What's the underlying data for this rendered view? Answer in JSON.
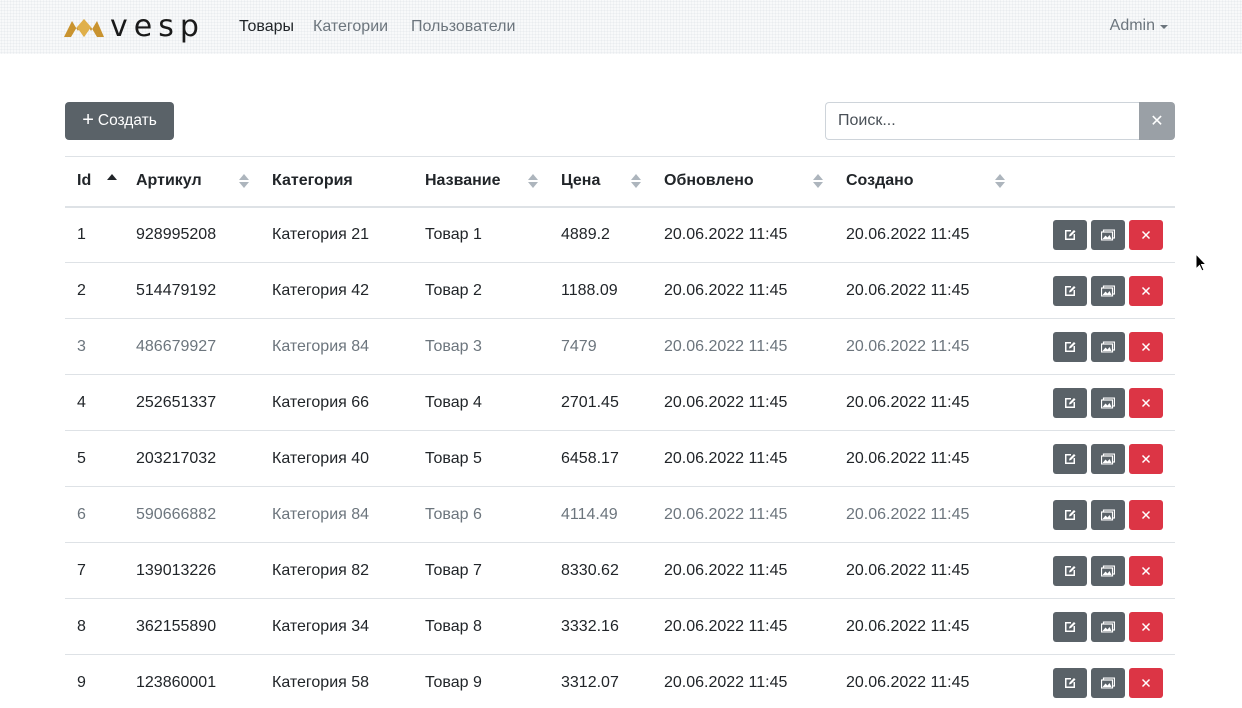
{
  "brand": {
    "name": "vesp"
  },
  "nav": {
    "items": [
      {
        "label": "Товары",
        "active": true
      },
      {
        "label": "Категории",
        "active": false
      },
      {
        "label": "Пользователи",
        "active": false
      }
    ],
    "user": "Admin"
  },
  "toolbar": {
    "create_label": "Создать",
    "search_placeholder": "Поиск...",
    "clear_symbol": "✕"
  },
  "table": {
    "columns": [
      "Id",
      "Артикул",
      "Категория",
      "Название",
      "Цена",
      "Обновлено",
      "Создано"
    ],
    "sort": {
      "column": "Id",
      "direction": "asc"
    },
    "rows": [
      {
        "id": "1",
        "sku": "928995208",
        "category": "Категория 21",
        "name": "Товар 1",
        "price": "4889.2",
        "updated": "20.06.2022 11:45",
        "created": "20.06.2022 11:45",
        "muted": false
      },
      {
        "id": "2",
        "sku": "514479192",
        "category": "Категория 42",
        "name": "Товар 2",
        "price": "1188.09",
        "updated": "20.06.2022 11:45",
        "created": "20.06.2022 11:45",
        "muted": false
      },
      {
        "id": "3",
        "sku": "486679927",
        "category": "Категория 84",
        "name": "Товар 3",
        "price": "7479",
        "updated": "20.06.2022 11:45",
        "created": "20.06.2022 11:45",
        "muted": true
      },
      {
        "id": "4",
        "sku": "252651337",
        "category": "Категория 66",
        "name": "Товар 4",
        "price": "2701.45",
        "updated": "20.06.2022 11:45",
        "created": "20.06.2022 11:45",
        "muted": false
      },
      {
        "id": "5",
        "sku": "203217032",
        "category": "Категория 40",
        "name": "Товар 5",
        "price": "6458.17",
        "updated": "20.06.2022 11:45",
        "created": "20.06.2022 11:45",
        "muted": false
      },
      {
        "id": "6",
        "sku": "590666882",
        "category": "Категория 84",
        "name": "Товар 6",
        "price": "4114.49",
        "updated": "20.06.2022 11:45",
        "created": "20.06.2022 11:45",
        "muted": true
      },
      {
        "id": "7",
        "sku": "139013226",
        "category": "Категория 82",
        "name": "Товар 7",
        "price": "8330.62",
        "updated": "20.06.2022 11:45",
        "created": "20.06.2022 11:45",
        "muted": false
      },
      {
        "id": "8",
        "sku": "362155890",
        "category": "Категория 34",
        "name": "Товар 8",
        "price": "3332.16",
        "updated": "20.06.2022 11:45",
        "created": "20.06.2022 11:45",
        "muted": false
      },
      {
        "id": "9",
        "sku": "123860001",
        "category": "Категория 58",
        "name": "Товар 9",
        "price": "3312.07",
        "updated": "20.06.2022 11:45",
        "created": "20.06.2022 11:45",
        "muted": false
      }
    ],
    "row_actions": [
      "edit-icon",
      "image-icon",
      "delete-icon"
    ]
  },
  "colors": {
    "logo_gold": "#c9932f",
    "button_grey": "#5a6268",
    "delete_red": "#dc3545",
    "muted_text": "#6c757d"
  }
}
